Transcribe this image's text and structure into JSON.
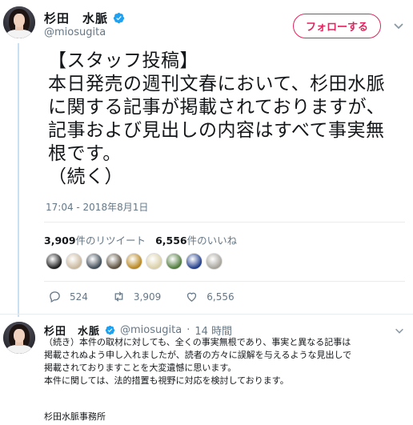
{
  "main_tweet": {
    "display_name": "杉田　水脈",
    "handle": "@miosugita",
    "follow_label": "フォローする",
    "text_lines": [
      "【スタッフ投稿】",
      "本日発売の週刊文春において、杉田水脈",
      "に関する記事が掲載されておりますが、",
      "記事および見出しの内容はすべて事実無",
      "根です。",
      "（続く）"
    ],
    "timestamp": "17:04 - 2018年8月1日",
    "retweets_count": "3,909",
    "retweets_label": "件のリツイート",
    "likes_count": "6,556",
    "likes_label": "件のいいね",
    "likers": [
      {
        "icon": "dark-avatar",
        "color": "#1b1b1b"
      },
      {
        "icon": "portrait-avatar",
        "color": "#c9b79c"
      },
      {
        "icon": "pattern-avatar",
        "color": "#3d4a55"
      },
      {
        "icon": "photo-avatar",
        "color": "#5a4e3c"
      },
      {
        "icon": "emblem-avatar",
        "color": "#b8861c"
      },
      {
        "icon": "flower-avatar",
        "color": "#d9cfa6"
      },
      {
        "icon": "character-avatar",
        "color": "#4e7a3a"
      },
      {
        "icon": "badge-avatar",
        "color": "#1f3c8a"
      },
      {
        "icon": "cat-avatar",
        "color": "#a6a29a"
      }
    ],
    "actions": {
      "reply_count": "524",
      "retweet_count": "3,909",
      "like_count": "6,556"
    }
  },
  "reply_tweet": {
    "display_name": "杉田　水脈",
    "handle": "@miosugita",
    "separator": "·",
    "time": "14 時間",
    "text_lines": [
      "（続き）本件の取材に対しても、全くの事実無根であり、事実と異なる記事は",
      "掲載されぬよう申し入れましたが、読者の方々に誤解を与えるような見出しで",
      "掲載されておりますことを大変遺憾に思います。",
      "本件に関しては、法的措置も視野に対応を検討しております。"
    ],
    "signature": "杉田水脈事務所"
  },
  "colors": {
    "accent_follow": "#e0245e",
    "verified": "#1da1f2",
    "muted_text": "#657786"
  }
}
